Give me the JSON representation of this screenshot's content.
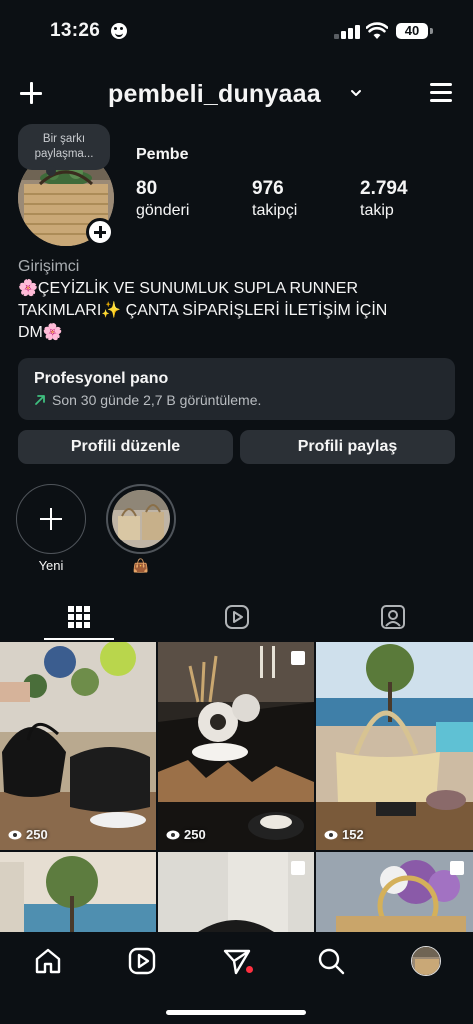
{
  "status_bar": {
    "time": "13:26",
    "battery": "40"
  },
  "header": {
    "username": "pembeli_dunyaaa"
  },
  "profile": {
    "note": "Bir şarkı paylaşma...",
    "display_name": "Pembe",
    "stats": [
      {
        "value": "80",
        "label": "gönderi"
      },
      {
        "value": "976",
        "label": "takipçi"
      },
      {
        "value": "2.794",
        "label": "takip"
      }
    ],
    "category": "Girişimci",
    "bio_line1": "🌸ÇEYİZLİK VE SUNUMLUK SUPLA RUNNER",
    "bio_line2": "TAKIMLARI✨ ÇANTA SİPARİŞLERİ İLETİŞİM İÇİN",
    "bio_line3": "DM🌸"
  },
  "pro_dashboard": {
    "title": "Profesyonel pano",
    "subtitle": "Son 30 günde 2,7 B görüntüleme."
  },
  "buttons": {
    "edit_profile": "Profili düzenle",
    "share_profile": "Profili paylaş"
  },
  "highlights": [
    {
      "label": "Yeni"
    },
    {
      "label": "👜"
    }
  ],
  "tabs": [
    {
      "icon": "grid-icon",
      "active": true
    },
    {
      "icon": "reels-icon",
      "active": false
    },
    {
      "icon": "tagged-icon",
      "active": false
    }
  ],
  "posts": [
    {
      "views": "250",
      "multi": false
    },
    {
      "views": "250",
      "multi": true
    },
    {
      "views": "152",
      "multi": false
    },
    {
      "views": "",
      "multi": false
    },
    {
      "views": "",
      "multi": true
    },
    {
      "views": "",
      "multi": true
    }
  ],
  "bottom_nav": [
    "home-icon",
    "reels-icon",
    "send-icon",
    "search-icon",
    "profile-avatar"
  ],
  "colors": {
    "background": "#0c1014",
    "card": "#22272d",
    "button": "#2b3036",
    "accent_green": "#3fbf7f",
    "notification_red": "#ff3040"
  }
}
